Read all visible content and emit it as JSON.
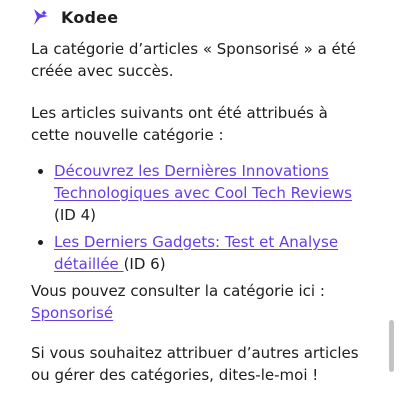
{
  "header": {
    "brand_name": "Kodee",
    "logo_icon": "kodee-star-logo-icon",
    "accent_color": "#673de6"
  },
  "message": {
    "paragraph1": "La catégorie d’articles « Sponsorisé » a été créée avec succès.",
    "paragraph2": "Les articles suivants ont été attribués à cette nouvelle catégorie :",
    "articles": [
      {
        "title": "Découvrez les Dernières Innovations Technologiques avec Cool Tech Reviews",
        "id_text": "(ID 4)"
      },
      {
        "title": "Les Derniers Gadgets: Test et Analyse détaillée ",
        "id_text": "(ID 6)"
      }
    ],
    "consult_text": "Vous pouvez consulter la catégorie ici :",
    "category_link": "Sponsorisé",
    "closing_text": "Si vous souhaitez attribuer d’autres articles ou gérer des catégories, dites-le-moi !"
  },
  "scrollbar": {
    "scroll_fraction": 0.9
  }
}
